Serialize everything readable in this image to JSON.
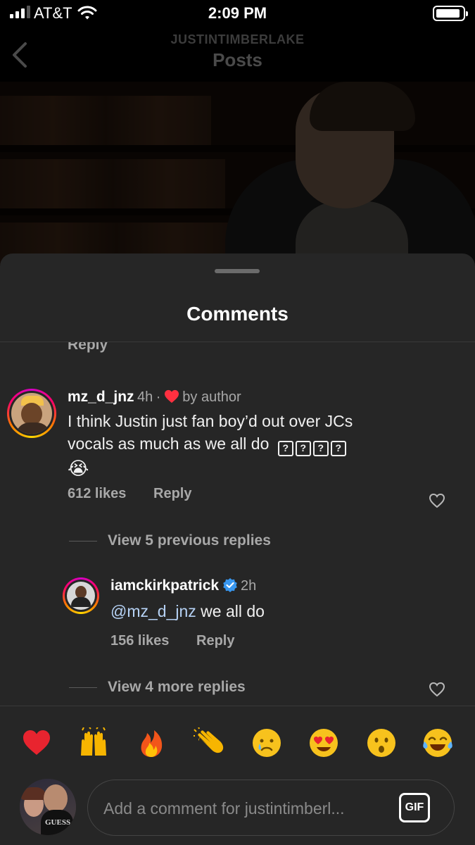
{
  "status_bar": {
    "carrier": "AT&T",
    "time": "2:09 PM"
  },
  "header": {
    "username": "JUSTINTIMBERLAKE",
    "title": "Posts"
  },
  "sheet": {
    "title": "Comments",
    "partial_reply_label": "Reply"
  },
  "comments": [
    {
      "username": "mz_d_jnz",
      "time": "4h",
      "separator": "·",
      "liked_by_author_label": "by author",
      "text_line_1": "I think Justin just fan boy’d out over JCs",
      "text_line_2": "vocals as much as we all do",
      "unknown_glyphs": [
        "?",
        "?",
        "?",
        "?"
      ],
      "trailing_emoji": "😭",
      "likes": "612 likes",
      "reply_label": "Reply",
      "view_replies_label": "View 5 previous replies"
    }
  ],
  "replies": [
    {
      "username": "iamckirkpatrick",
      "verified": true,
      "time": "2h",
      "mention": "@mz_d_jnz",
      "text": " we all do",
      "likes": "156 likes",
      "reply_label": "Reply",
      "view_more_label": "View 4 more replies"
    }
  ],
  "emoji_reactions": [
    "heart",
    "raised-hands",
    "fire",
    "clapping-hands",
    "crying-face",
    "heart-eyes",
    "surprised-face",
    "tears-of-joy"
  ],
  "composer": {
    "placeholder": "Add a comment for justintimberl...",
    "gif_label": "GIF",
    "avatar_shirt_text": "GUESS"
  },
  "colors": {
    "background": "#262626",
    "accent_red": "#ff3040",
    "verified_blue": "#3897f0",
    "muted_text": "#a8a8a8"
  }
}
